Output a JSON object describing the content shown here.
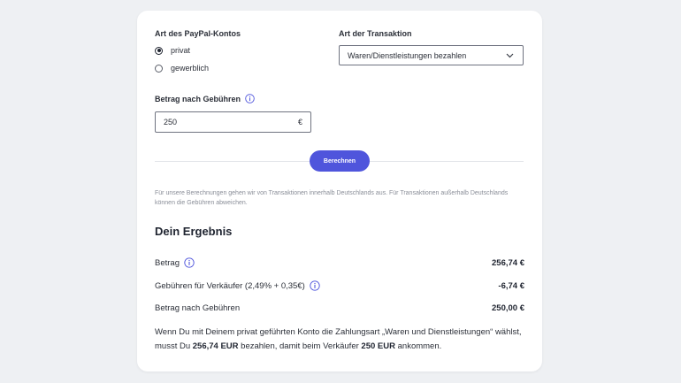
{
  "account": {
    "label": "Art des PayPal-Kontos",
    "options": [
      "privat",
      "gewerblich"
    ],
    "selected": "privat"
  },
  "transaction": {
    "label": "Art der Transaktion",
    "selected": "Waren/Dienstleistungen bezahlen"
  },
  "amount": {
    "label": "Betrag nach Gebühren",
    "value": "250",
    "currency": "€"
  },
  "calculate_button": "Berechnen",
  "note": "Für unsere Berechnungen gehen wir von Transaktionen innerhalb Deutschlands aus. Für Transaktionen außerhalb Deutschlands können die Gebühren abweichen.",
  "result": {
    "title": "Dein Ergebnis",
    "rows": [
      {
        "label": "Betrag",
        "value": "256,74 €"
      },
      {
        "label": "Gebühren für Verkäufer (2,49% + 0,35€)",
        "value": "-6,74 €"
      },
      {
        "label": "Betrag nach Gebühren",
        "value": "250,00 €"
      }
    ],
    "summary": {
      "part1": "Wenn Du mit Deinem privat geführten Konto die Zahlungsart „Waren und Dienstleistungen“ wählst, musst Du ",
      "amount_pay": "256,74 EUR",
      "part2": " bezahlen, damit beim Verkäufer ",
      "amount_receive": "250 EUR",
      "part3": " ankommen."
    }
  },
  "colors": {
    "accent": "#4f55dc",
    "background": "#eef0f3",
    "info_icon": "#4f55dc"
  },
  "icons": {
    "info": "info-icon",
    "chevron": "chevron-down-icon"
  }
}
